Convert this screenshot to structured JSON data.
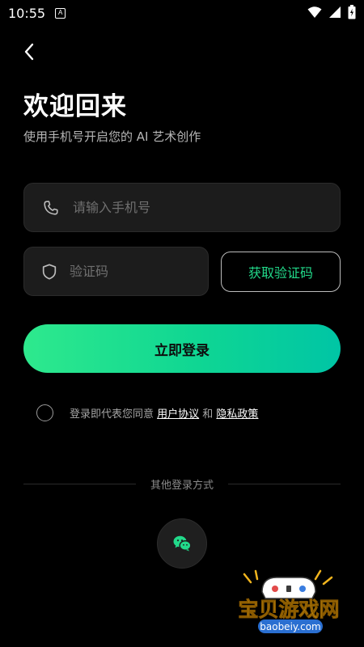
{
  "status": {
    "time": "10:55"
  },
  "header": {
    "title": "欢迎回来",
    "subtitle": "使用手机号开启您的 AI 艺术创作"
  },
  "form": {
    "phone_placeholder": "请输入手机号",
    "code_placeholder": "验证码",
    "get_code_label": "获取验证码",
    "login_label": "立即登录"
  },
  "agreement": {
    "prefix": "登录即代表您同意 ",
    "user_agreement": "用户协议",
    "and": " 和 ",
    "privacy_policy": "隐私政策"
  },
  "other_login": {
    "label": "其他登录方式"
  },
  "colors": {
    "accent_green": "#22d98a",
    "gradient_start": "#2ee98d",
    "gradient_end": "#00c5a5",
    "background": "#000000",
    "field_bg": "#1c1c1c"
  },
  "icons": [
    "back-icon",
    "phone-icon",
    "shield-icon",
    "wechat-icon",
    "wifi-icon",
    "signal-icon",
    "battery-icon"
  ],
  "watermark": {
    "brand": "宝贝游戏网",
    "domain": "baobeiy.com"
  }
}
